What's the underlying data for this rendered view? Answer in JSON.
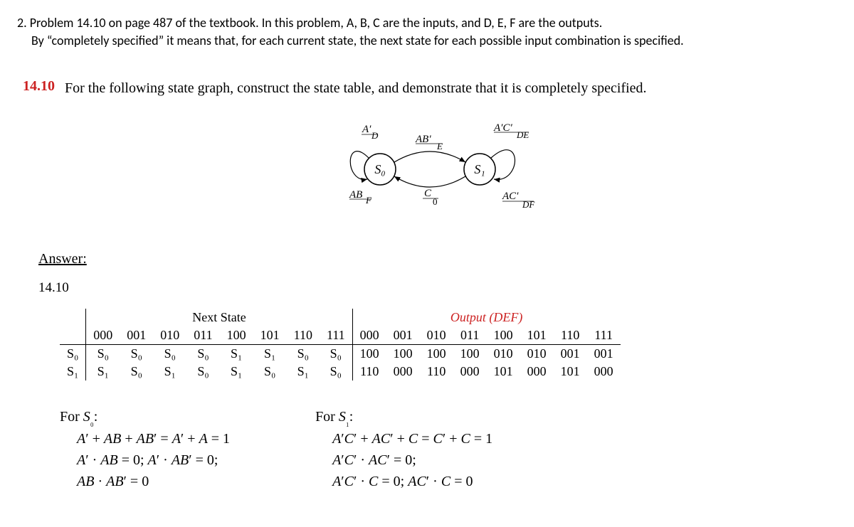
{
  "intro_line1": "2. Problem 14.10 on page 487 of the textbook. In this problem, A, B, C are the inputs, and D, E, F are the outputs.",
  "intro_line2": "By “completely specified” it means   that, for each current state, the next state for each possible input combination is specified.",
  "problem": {
    "number": "14.10",
    "text": "For the following state graph, construct the state table, and demonstrate that it is completely specified."
  },
  "diagram": {
    "state0": "S₀",
    "state1": "S₁",
    "edge_s0_self_top": "A'/D",
    "edge_s0_self_bot": "AB/F",
    "edge_s0_s1_top": "AB'/E",
    "edge_s1_s0_bot": "C/0",
    "edge_s1_self_top": "A'C'/DE",
    "edge_s1_self_bot": "AC'/DF"
  },
  "answer_heading": "Answer:",
  "answer_number": "14.10",
  "table": {
    "next_state_hdr": "Next State",
    "output_hdr": "Output (DEF)",
    "cols": [
      "000",
      "001",
      "010",
      "011",
      "100",
      "101",
      "110",
      "111"
    ],
    "rows": [
      {
        "label": "S₀",
        "ns": [
          "S₀",
          "S₀",
          "S₀",
          "S₀",
          "S₁",
          "S₁",
          "S₀",
          "S₀"
        ],
        "out": [
          "100",
          "100",
          "100",
          "100",
          "010",
          "010",
          "001",
          "001"
        ]
      },
      {
        "label": "S₁",
        "ns": [
          "S₁",
          "S₀",
          "S₁",
          "S₀",
          "S₁",
          "S₀",
          "S₁",
          "S₀"
        ],
        "out": [
          "110",
          "000",
          "110",
          "000",
          "101",
          "000",
          "101",
          "000"
        ]
      }
    ]
  },
  "equations": {
    "s0": {
      "title": "For S₀:",
      "lines": [
        "A' + AB + AB' = A' + A = 1",
        "A' · AB = 0; A' · AB' = 0;",
        "AB · AB' = 0"
      ]
    },
    "s1": {
      "title": "For S₁:",
      "lines": [
        "A'C' + AC' + C = C' + C = 1",
        "A'C' · AC' = 0;",
        "A'C' · C = 0; AC' · C = 0"
      ]
    }
  }
}
